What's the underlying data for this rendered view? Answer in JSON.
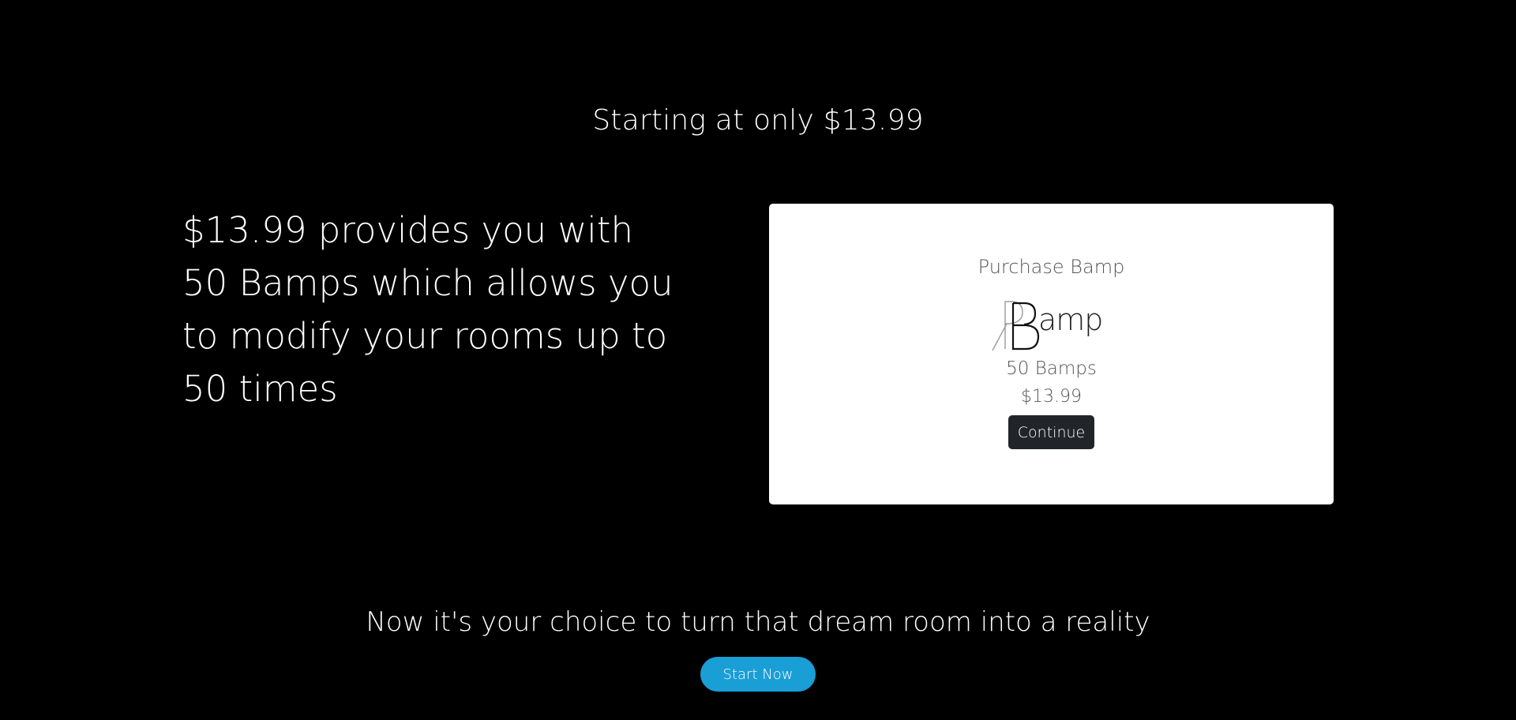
{
  "hero": {
    "headline": "Starting at only $13.99",
    "description": "$13.99 provides you with 50 Bamps which allows you to modify your rooms up to 50 times"
  },
  "purchase_card": {
    "title": "Purchase Bamp",
    "logo_text": "RBamp",
    "amount": "50 Bamps",
    "price": "$13.99",
    "continue_label": "Continue"
  },
  "cta": {
    "tagline": "Now it's your choice to turn that dream room into a reality",
    "start_label": "Start Now"
  },
  "colors": {
    "background": "#000000",
    "card_background": "#ffffff",
    "continue_button": "#212529",
    "start_button": "#1a9ed6"
  }
}
